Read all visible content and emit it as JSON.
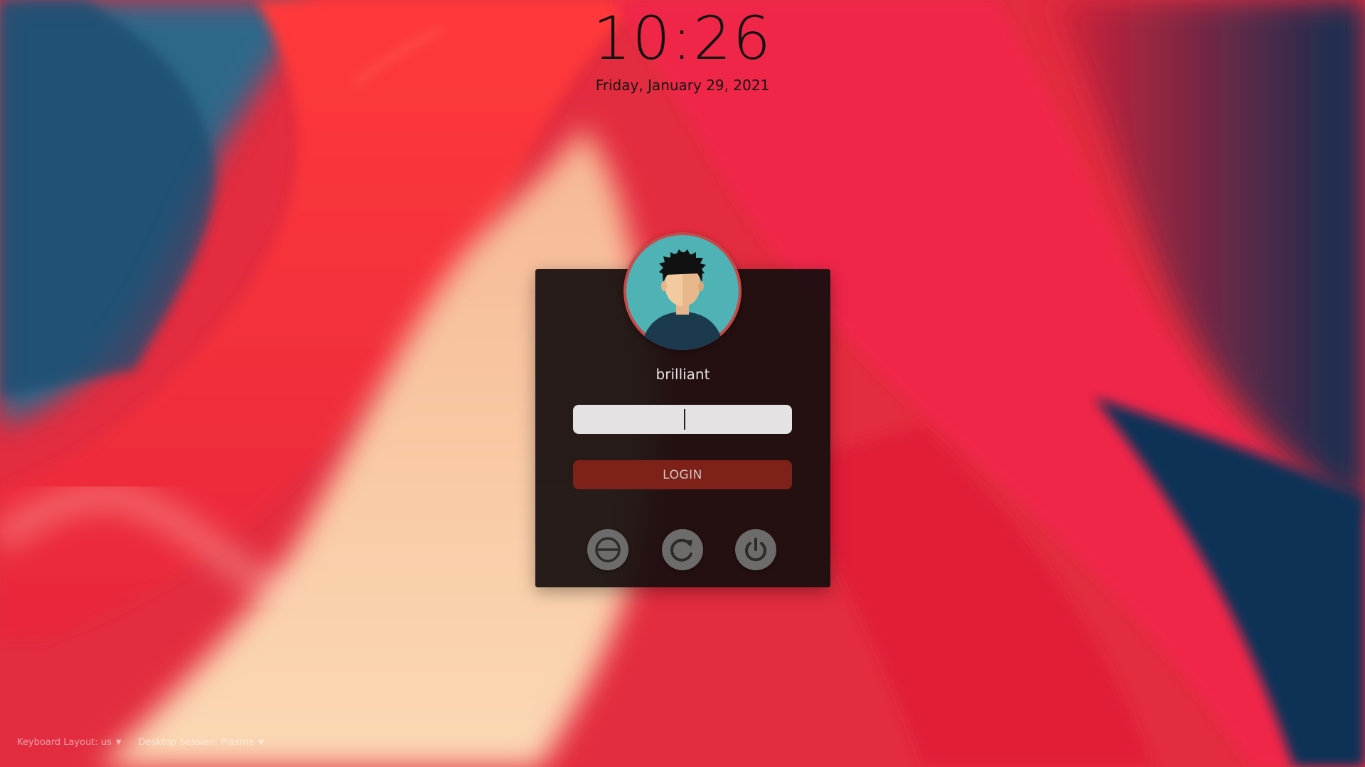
{
  "lockscreen": {
    "time": "10:26",
    "date": "Friday, January 29, 2021"
  },
  "user": {
    "name": "brilliant",
    "avatar_icon": "user-avatar-icon"
  },
  "password": {
    "value": "",
    "placeholder": ""
  },
  "login": {
    "label": "LOGIN"
  },
  "power_actions": [
    {
      "name": "suspend",
      "icon": "suspend-icon"
    },
    {
      "name": "restart",
      "icon": "restart-icon"
    },
    {
      "name": "shutdown",
      "icon": "power-icon"
    }
  ],
  "bottom_bar": {
    "keyboard_layout_label": "Keyboard Layout: us",
    "session_label": "Desktop Session: Plasma"
  },
  "colors": {
    "card_bg": "#160e0e",
    "login_button": "#7e2219",
    "password_field": "#e4e2e2",
    "avatar_bg": "#4fb3b6",
    "avatar_ring": "#c64a4a",
    "power_buttons": "#6e6b6b"
  }
}
